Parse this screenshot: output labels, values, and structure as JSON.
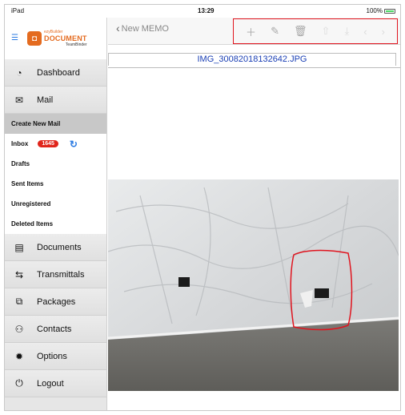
{
  "status_bar": {
    "device": "iPad",
    "time": "13:29",
    "battery": "100%"
  },
  "app": {
    "logo_small": "ezyBuilder",
    "logo_big": "DOCUMENT",
    "logo_tag": "TeamBinder"
  },
  "topbar": {
    "back_label": "New MEMO",
    "tools": [
      "add-icon",
      "edit-icon",
      "trash-icon",
      "share-icon",
      "download-icon",
      "previous-icon",
      "next-icon"
    ]
  },
  "file_name": "IMG_30082018132642.JPG",
  "sidebar": {
    "dashboard": "Dashboard",
    "mail": "Mail",
    "mail_items": {
      "create": "Create New Mail",
      "inbox": "Inbox",
      "inbox_count": "1645",
      "drafts": "Drafts",
      "sent": "Sent Items",
      "unregistered": "Unregistered",
      "deleted": "Deleted Items"
    },
    "documents": "Documents",
    "transmittals": "Transmittals",
    "packages": "Packages",
    "contacts": "Contacts",
    "options": "Options",
    "logout": "Logout"
  },
  "colors": {
    "accent": "#2a7ae2",
    "badge": "#e0251b",
    "highlight": "#e0141e",
    "link": "#1a3fb5"
  }
}
